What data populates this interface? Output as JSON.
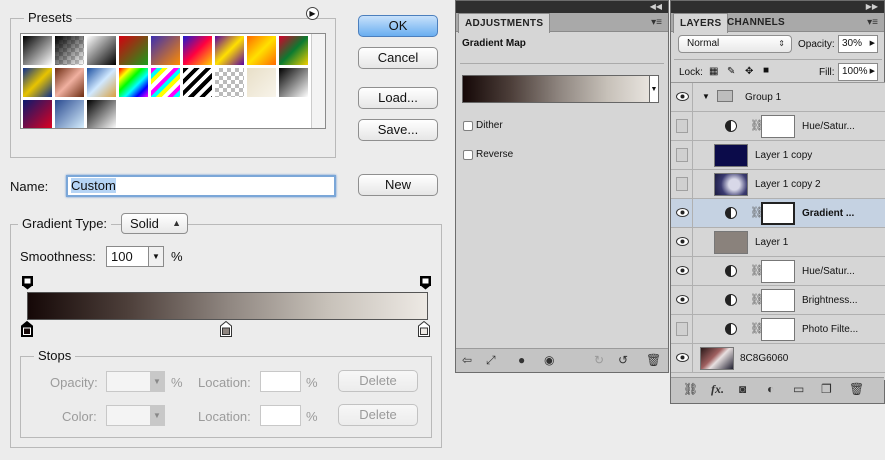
{
  "editor": {
    "presets_label": "Presets",
    "ok": "OK",
    "cancel": "Cancel",
    "load": "Load...",
    "save": "Save...",
    "name_label": "Name:",
    "name_value": "Custom",
    "new": "New",
    "gradient_type_label": "Gradient Type:",
    "gradient_type_value": "Solid",
    "smoothness_label": "Smoothness:",
    "smoothness_value": "100",
    "smoothness_unit": "%",
    "stops_label": "Stops",
    "opacity_label": "Opacity:",
    "color_label": "Color:",
    "location_label": "Location:",
    "percent": "%",
    "delete": "Delete"
  },
  "adjustments": {
    "tab": "ADJUSTMENTS",
    "title": "Gradient Map",
    "dither": "Dither",
    "reverse": "Reverse"
  },
  "layers_panel": {
    "tab_layers": "LAYERS",
    "tab_channels": "CHANNELS",
    "blend_mode": "Normal",
    "opacity_label": "Opacity:",
    "opacity_value": "30%",
    "lock_label": "Lock:",
    "fill_label": "Fill:",
    "fill_value": "100%",
    "layers": [
      {
        "name": "Group 1"
      },
      {
        "name": "Hue/Satur..."
      },
      {
        "name": "Layer 1 copy"
      },
      {
        "name": "Layer 1 copy 2"
      },
      {
        "name": "Gradient ..."
      },
      {
        "name": "Layer 1"
      },
      {
        "name": "Hue/Satur..."
      },
      {
        "name": "Brightness..."
      },
      {
        "name": "Photo Filte..."
      },
      {
        "name": "8C8G6060"
      }
    ]
  },
  "colors": {
    "accent_blue": "#6aaef0",
    "selected_row": "#c5d2e2",
    "panel_bg": "#d6d6d6"
  }
}
